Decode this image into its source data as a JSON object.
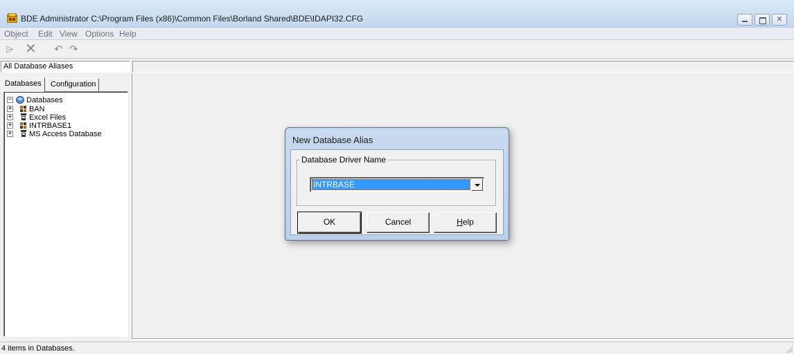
{
  "window": {
    "title": "BDE Administrator  C:\\Program Files (x86)\\Common Files\\Borland Shared\\BDE\\IDAPI32.CFG",
    "close_glyph": "✕"
  },
  "menu": [
    "Object",
    "Edit",
    "View",
    "Options",
    "Help"
  ],
  "toolbar": {
    "icons": [
      "open-icon",
      "delete-icon",
      "undo-icon",
      "redo-icon"
    ],
    "glyphs": [
      "⌲",
      "✕",
      "↶",
      "↷"
    ]
  },
  "selection_label": "All Database Aliases",
  "tabs": [
    "Databases",
    "Configuration"
  ],
  "tree": {
    "root": {
      "label": "Databases",
      "expander": "−"
    },
    "children": [
      {
        "label": "BAN",
        "expander": "+",
        "icon": "database-alias-icon"
      },
      {
        "label": "Excel Files",
        "expander": "+",
        "icon": "odbc-alias-icon"
      },
      {
        "label": "INTRBASE1",
        "expander": "+",
        "icon": "database-alias-icon"
      },
      {
        "label": "MS Access Database",
        "expander": "+",
        "icon": "odbc-alias-icon"
      }
    ]
  },
  "status": "4 items in Databases.",
  "dialog": {
    "title": "New Database Alias",
    "group_label": "Database Driver Name",
    "driver_value": "INTRBASE",
    "buttons": {
      "ok": "OK",
      "cancel": "Cancel",
      "help": "Help"
    }
  }
}
